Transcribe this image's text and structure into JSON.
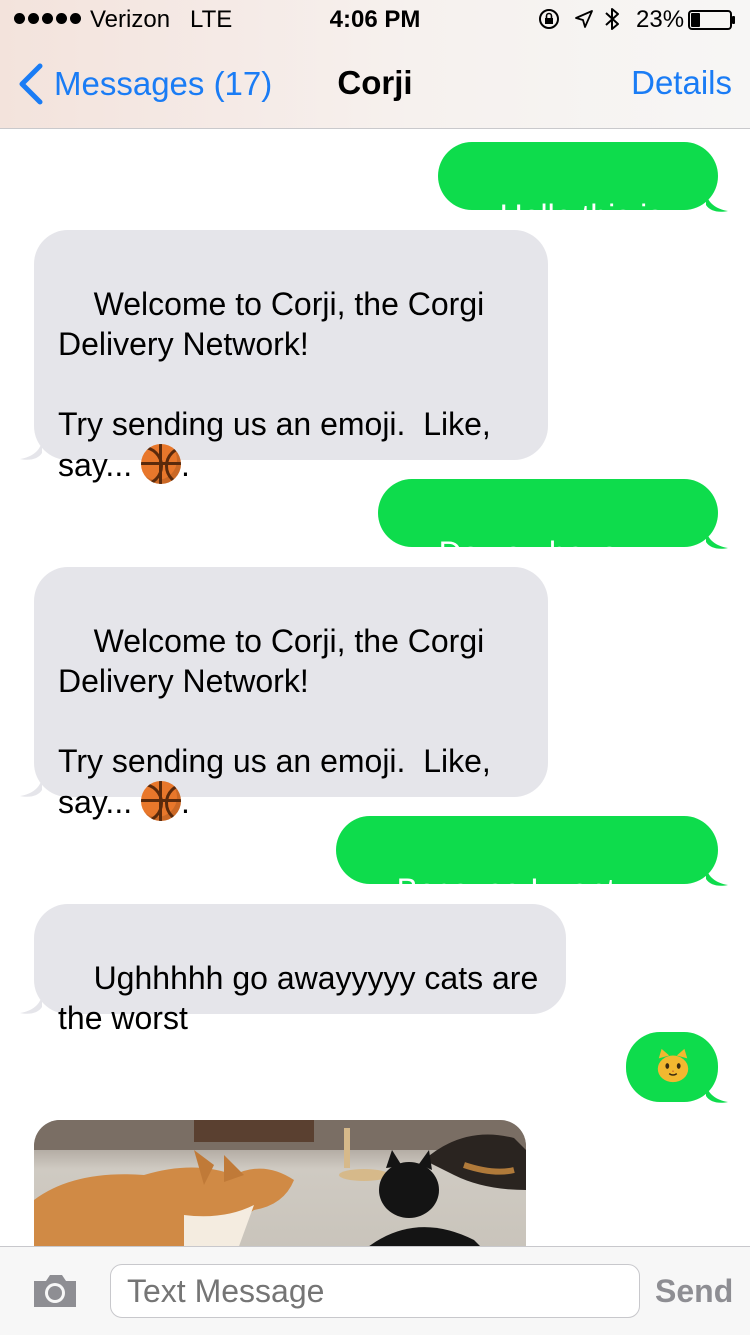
{
  "status_bar": {
    "carrier": "Verizon",
    "network": "LTE",
    "time": "4:06 PM",
    "battery_percent": "23%",
    "icons": [
      "signal-dots-icon",
      "orientation-lock-icon",
      "location-arrow-icon",
      "bluetooth-icon",
      "battery-icon"
    ]
  },
  "nav": {
    "back_label": "Messages (17)",
    "title": "Corji",
    "details_label": "Details"
  },
  "messages": [
    {
      "direction": "outgoing",
      "text": "Hello this is cat"
    },
    {
      "direction": "incoming",
      "line1": "Welcome to Corji, the Corgi\nDelivery Network!\n\nTry sending us an emoji.  Like,\nsay... ",
      "emoji": "basketball-emoji",
      "line2": "."
    },
    {
      "direction": "outgoing",
      "text": "Do you have catnip"
    },
    {
      "direction": "incoming",
      "line1": "Welcome to Corji, the Corgi\nDelivery Network!\n\nTry sending us an emoji.  Like,\nsay... ",
      "emoji": "basketball-emoji",
      "line2": "."
    },
    {
      "direction": "outgoing",
      "text": "Because I want catnip"
    },
    {
      "direction": "incoming",
      "text": "Ughhhhh go awayyyyy cats are\nthe worst"
    },
    {
      "direction": "outgoing",
      "emoji": "cat-face-emoji"
    },
    {
      "direction": "incoming",
      "image": "corgi-and-cat-photo"
    }
  ],
  "composer": {
    "placeholder": "Text Message",
    "send_label": "Send"
  },
  "colors": {
    "outgoing_bubble": "#0edc4c",
    "incoming_bubble": "#e5e5ea",
    "accent": "#1a7cf5"
  }
}
